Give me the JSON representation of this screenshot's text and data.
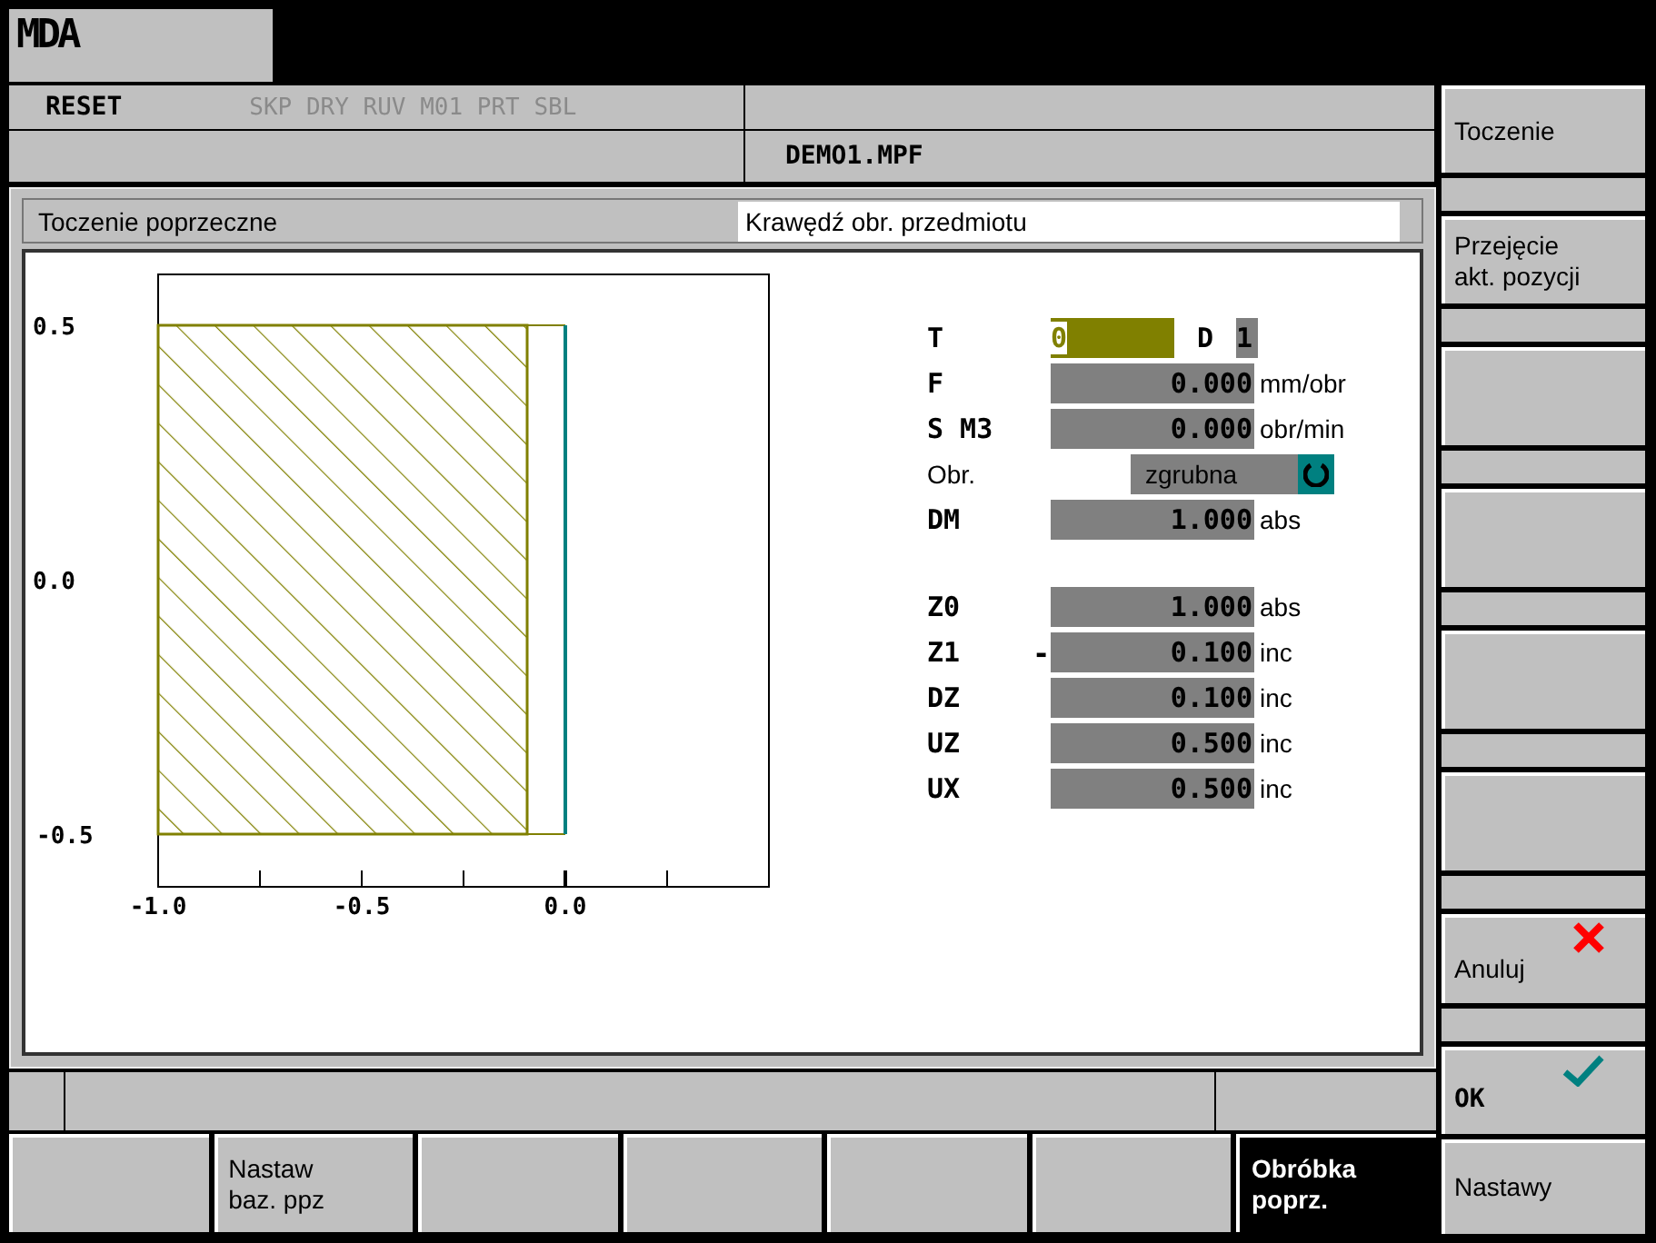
{
  "header": {
    "mode": "MDA"
  },
  "info_bar": {
    "state": "RESET",
    "program_controls": "SKP DRY RUV M01 PRT SBL",
    "program": "DEMO1.MPF"
  },
  "dialog": {
    "title": "Toczenie poprzeczne",
    "hint": "Krawędź obr. przedmiotu",
    "drawing": {
      "y_labels": [
        "0.5",
        "0.0",
        "-0.5"
      ],
      "x_labels": [
        "-1.0",
        "-0.5",
        "0.0"
      ]
    },
    "groups": [
      [
        {
          "kind": "tool",
          "label": "T",
          "value": "0",
          "focused": true,
          "d_label": "D",
          "d_value": "1"
        },
        {
          "kind": "number",
          "label": "F",
          "value": "0.000",
          "unit": "mm/obr",
          "focused": false
        },
        {
          "kind": "number",
          "label": "S M3",
          "value": "0.000",
          "unit": "obr/min",
          "focused": false
        },
        {
          "kind": "choice",
          "label": "Obr.",
          "value": "zgrubna",
          "focused": false
        },
        {
          "kind": "number",
          "label": "DM",
          "value": "1.000",
          "unit": "abs",
          "focused": false
        }
      ],
      [
        {
          "kind": "number",
          "label": "Z0",
          "value": "1.000",
          "unit": "abs",
          "focused": false
        },
        {
          "kind": "number",
          "label": "Z1",
          "sign": "-",
          "value": "0.100",
          "unit": "inc",
          "focused": false
        },
        {
          "kind": "number",
          "label": "DZ",
          "value": "0.100",
          "unit": "inc",
          "focused": false
        },
        {
          "kind": "number",
          "label": "UZ",
          "value": "0.500",
          "unit": "inc",
          "focused": false
        },
        {
          "kind": "number",
          "label": "UX",
          "value": "0.500",
          "unit": "inc",
          "focused": false
        }
      ]
    ]
  },
  "vertical_softkeys": [
    {
      "kind": "text",
      "label": "Toczenie"
    },
    {
      "kind": "text",
      "label": "Przejęcie\nakt. pozycji"
    },
    {
      "kind": "empty"
    },
    {
      "kind": "empty"
    },
    {
      "kind": "empty"
    },
    {
      "kind": "empty"
    },
    {
      "kind": "cancel",
      "label": "Anuluj"
    },
    {
      "kind": "ok",
      "label": "OK"
    }
  ],
  "horizontal_softkeys": [
    {
      "selected": false
    },
    {
      "label": "Nastaw\nbaz. ppz",
      "selected": false
    },
    {
      "selected": false
    },
    {
      "selected": false
    },
    {
      "selected": false
    },
    {
      "selected": false
    },
    {
      "label": "Obróbka\npoprz.",
      "selected": true
    }
  ],
  "corner_softkey": {
    "label": "Nastawy"
  }
}
